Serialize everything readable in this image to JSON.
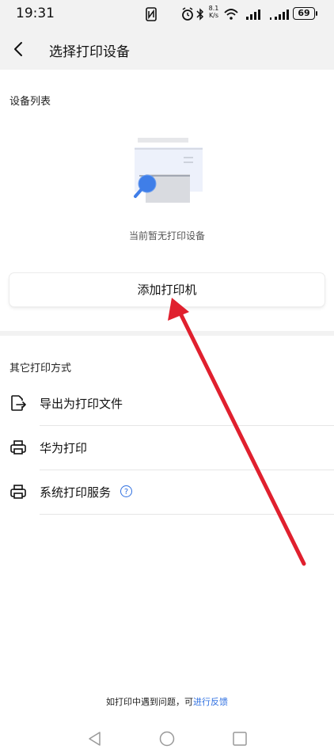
{
  "status_bar": {
    "time": "19:31",
    "net_speed_top": "8.1",
    "net_speed_bottom": "K/s",
    "battery": "69",
    "icons": [
      "nfc-icon",
      "alarm-icon",
      "bluetooth-icon",
      "wifi-icon",
      "signal-icon",
      "signal-icon",
      "battery-icon"
    ]
  },
  "header": {
    "title": "选择打印设备",
    "back_icon": "back-arrow-icon"
  },
  "device_list": {
    "section_title": "设备列表",
    "empty_text": "当前暂无打印设备",
    "add_button_label": "添加打印机"
  },
  "other_methods": {
    "section_title": "其它打印方式",
    "items": [
      {
        "label": "导出为打印文件",
        "icon": "export-file-icon"
      },
      {
        "label": "华为打印",
        "icon": "printer-icon"
      },
      {
        "label": "系统打印服务",
        "icon": "printer-icon",
        "help": "?"
      }
    ]
  },
  "footer": {
    "text": "如打印中遇到问题，可",
    "link": "进行反馈"
  },
  "colors": {
    "accent": "#2e6fe0",
    "annotation_arrow": "#e0202e",
    "header_bg": "#f2f2f2"
  }
}
